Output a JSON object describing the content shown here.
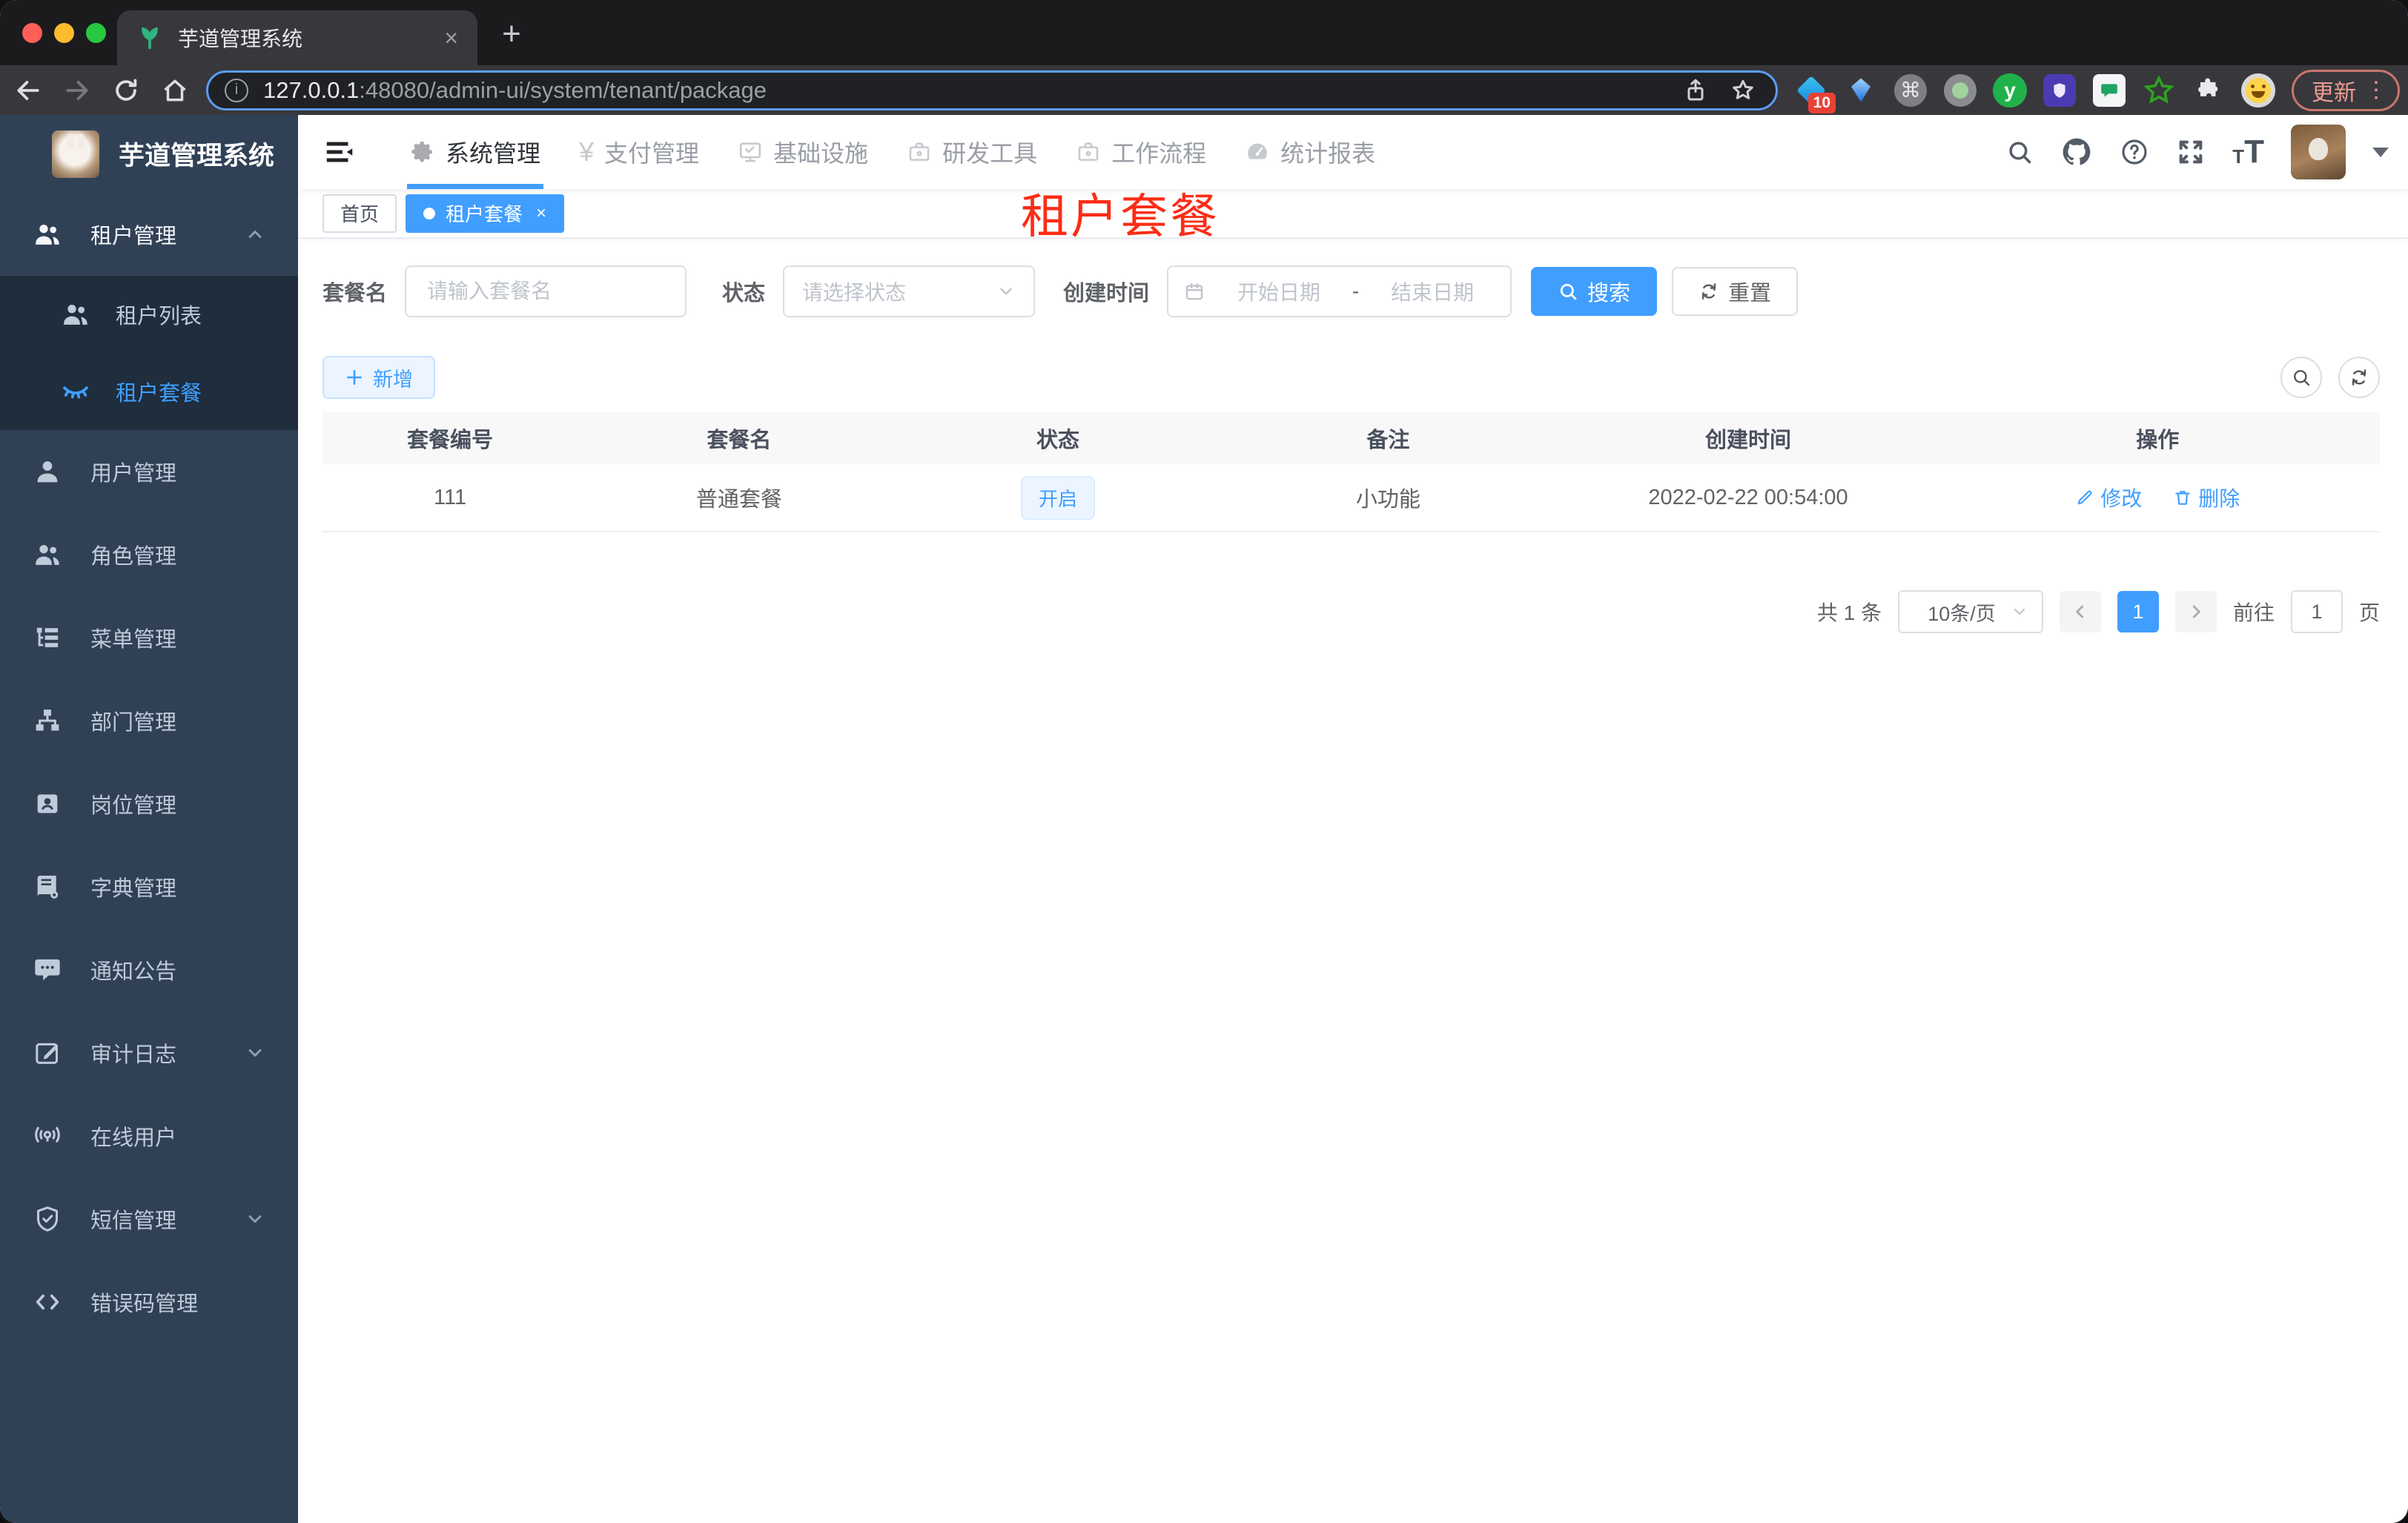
{
  "browser": {
    "tab_title": "芋道管理系统",
    "url_host": "127.0.0.1",
    "url_rest": ":48080/admin-ui/system/tenant/package",
    "update_label": "更新",
    "ext_badge": "10"
  },
  "colors": {
    "primary": "#409eff",
    "overlay_red": "#fb2c16",
    "sidebar_bg": "#304156",
    "submenu_bg": "#1f2d3d"
  },
  "app": {
    "brand": "芋道管理系统",
    "top_nav": [
      {
        "label": "系统管理"
      },
      {
        "label": "支付管理"
      },
      {
        "label": "基础设施"
      },
      {
        "label": "研发工具"
      },
      {
        "label": "工作流程"
      },
      {
        "label": "统计报表"
      }
    ],
    "sidebar": [
      {
        "label": "租户管理"
      },
      {
        "label": "租户列表"
      },
      {
        "label": "租户套餐"
      },
      {
        "label": "用户管理"
      },
      {
        "label": "角色管理"
      },
      {
        "label": "菜单管理"
      },
      {
        "label": "部门管理"
      },
      {
        "label": "岗位管理"
      },
      {
        "label": "字典管理"
      },
      {
        "label": "通知公告"
      },
      {
        "label": "审计日志"
      },
      {
        "label": "在线用户"
      },
      {
        "label": "短信管理"
      },
      {
        "label": "错误码管理"
      }
    ],
    "tags": {
      "home": "首页",
      "active": "租户套餐"
    },
    "overlay": "租户套餐",
    "filter": {
      "name_label": "套餐名",
      "name_placeholder": "请输入套餐名",
      "status_label": "状态",
      "status_placeholder": "请选择状态",
      "time_label": "创建时间",
      "start_placeholder": "开始日期",
      "range_sep": "-",
      "end_placeholder": "结束日期",
      "search": "搜索",
      "reset": "重置"
    },
    "actions": {
      "add": "新增"
    },
    "table": {
      "headers": [
        "套餐编号",
        "套餐名",
        "状态",
        "备注",
        "创建时间",
        "操作"
      ],
      "rows": [
        {
          "id": "111",
          "name": "普通套餐",
          "status": "开启",
          "remark": "小功能",
          "created": "2022-02-22 00:54:00",
          "edit": "修改",
          "delete": "删除"
        }
      ]
    },
    "pagination": {
      "total": "共 1 条",
      "size": "10条/页",
      "page": "1",
      "goto": "前往",
      "goto_value": "1",
      "unit": "页"
    }
  }
}
